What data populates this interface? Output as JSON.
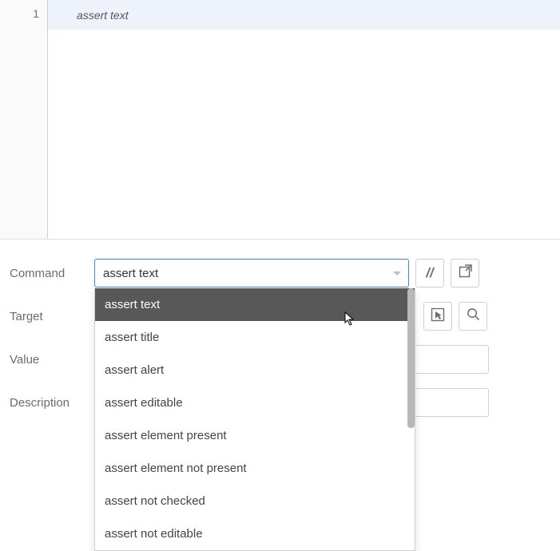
{
  "table": {
    "rows": [
      {
        "index": "1",
        "command": "assert text"
      }
    ]
  },
  "form": {
    "command": {
      "label": "Command",
      "value": "assert text"
    },
    "target": {
      "label": "Target"
    },
    "value": {
      "label": "Value"
    },
    "description": {
      "label": "Description"
    }
  },
  "dropdown": {
    "items": [
      "assert text",
      "assert title",
      "assert alert",
      "assert editable",
      "assert element present",
      "assert element not present",
      "assert not checked",
      "assert not editable"
    ],
    "selected_index": 0
  },
  "icons": {
    "slash": "//"
  }
}
